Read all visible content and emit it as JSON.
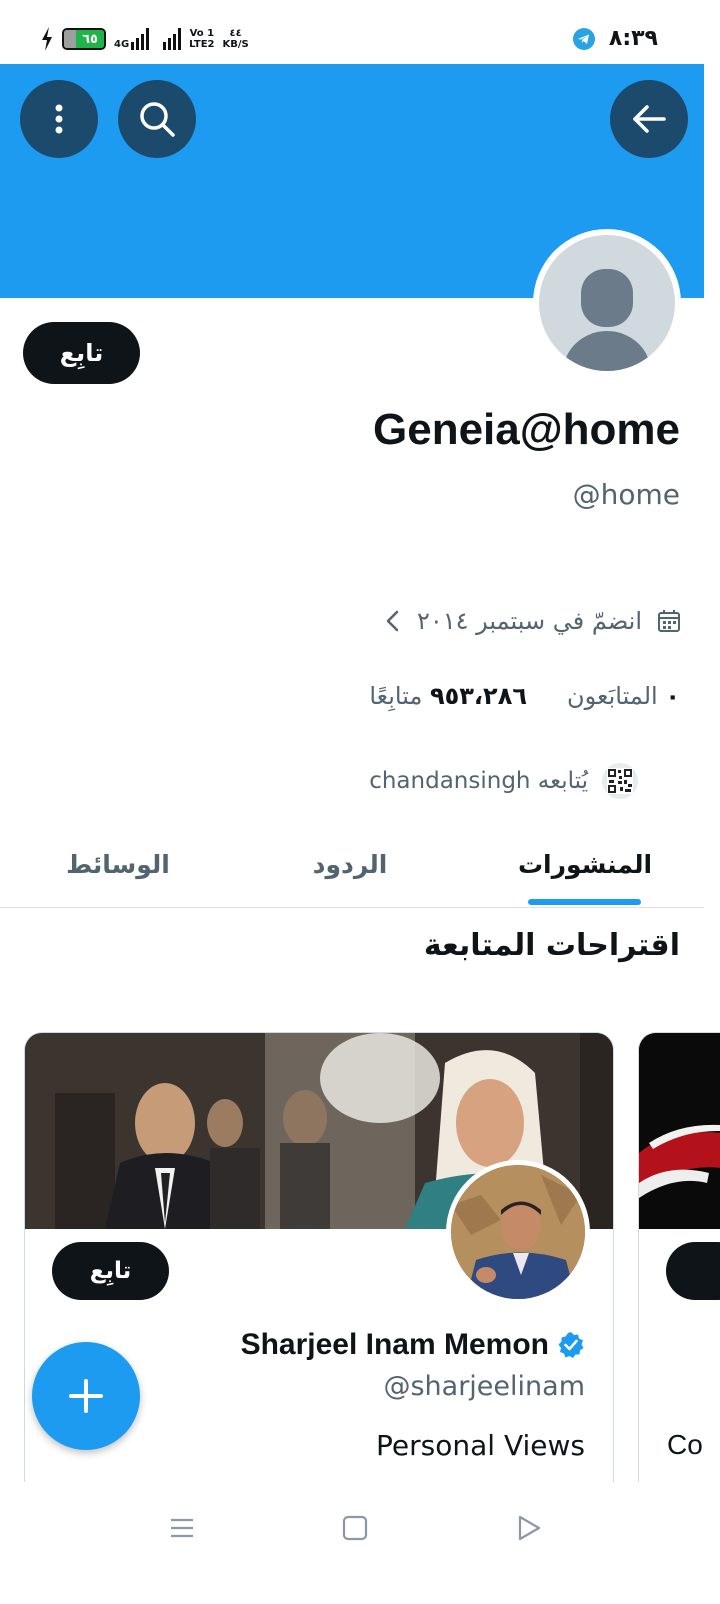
{
  "status_bar": {
    "battery": "٦٥",
    "network": "4G",
    "volte_top": "Vo 1",
    "volte_bottom": "LTE2",
    "speed_value": "٤٤",
    "speed_unit": "KB/S",
    "time": "٨:٣٩"
  },
  "profile": {
    "follow_label": "تابِع",
    "display_name": "Geneia@home",
    "handle": "@home",
    "joined": "انضمّ في سبتمبر ٢٠١٤",
    "following_count": "٩٥٣،٢٨٦",
    "following_label": "متابِعًا",
    "followers_count": "٠",
    "followers_label": "المتابَعون",
    "followed_by": "يُتابعه chandansingh"
  },
  "tabs": {
    "posts": "المنشورات",
    "replies": "الردود",
    "media": "الوسائط"
  },
  "suggestions": {
    "title": "اقتراحات المتابعة",
    "card": {
      "follow_label": "تابِع",
      "name": "Sharjeel Inam Memon",
      "handle": "@sharjeelinam",
      "bio": "Personal Views"
    },
    "card2": {
      "bio_partial": "Co"
    }
  },
  "colors": {
    "accent": "#1d9bf0",
    "banner": "#1d9bf0",
    "icon_button": "#1c4a6d",
    "text_primary": "#0f1419",
    "text_secondary": "#536471",
    "battery_fill": "#1fb34a"
  },
  "icons": {
    "back": "arrow-left-icon",
    "search": "search-icon",
    "more": "more-vertical-icon",
    "calendar": "calendar-icon",
    "chevron": "chevron-left-icon",
    "verified": "verified-badge-icon",
    "compose": "plus-icon"
  }
}
